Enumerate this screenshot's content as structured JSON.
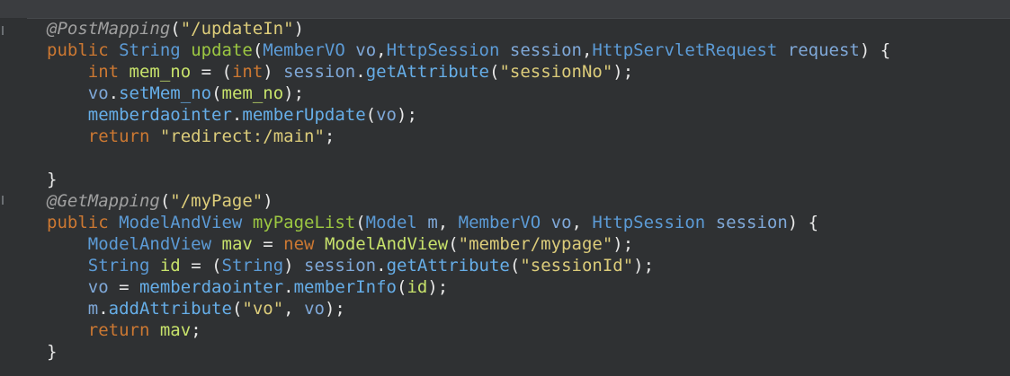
{
  "editor": {
    "lines": [
      [
        {
          "t": "@PostMapping",
          "c": "ann"
        },
        {
          "t": "(",
          "c": "punc"
        },
        {
          "t": "\"/updateIn\"",
          "c": "str"
        },
        {
          "t": ")",
          "c": "punc"
        }
      ],
      [
        {
          "t": "public",
          "c": "kw"
        },
        {
          "t": " ",
          "c": "punc"
        },
        {
          "t": "String",
          "c": "type"
        },
        {
          "t": " ",
          "c": "punc"
        },
        {
          "t": "update",
          "c": "fn"
        },
        {
          "t": "(",
          "c": "punc"
        },
        {
          "t": "MemberVO",
          "c": "type"
        },
        {
          "t": " ",
          "c": "punc"
        },
        {
          "t": "vo",
          "c": "param"
        },
        {
          "t": ",",
          "c": "punc"
        },
        {
          "t": "HttpSession",
          "c": "type"
        },
        {
          "t": " ",
          "c": "punc"
        },
        {
          "t": "session",
          "c": "param"
        },
        {
          "t": ",",
          "c": "punc"
        },
        {
          "t": "HttpServletRequest",
          "c": "type"
        },
        {
          "t": " ",
          "c": "punc"
        },
        {
          "t": "request",
          "c": "param"
        },
        {
          "t": ") {",
          "c": "punc"
        }
      ],
      [
        {
          "t": "    ",
          "c": "punc"
        },
        {
          "t": "int",
          "c": "kw"
        },
        {
          "t": " ",
          "c": "punc"
        },
        {
          "t": "mem_no",
          "c": "field"
        },
        {
          "t": " = (",
          "c": "op"
        },
        {
          "t": "int",
          "c": "kw"
        },
        {
          "t": ") ",
          "c": "punc"
        },
        {
          "t": "session",
          "c": "param"
        },
        {
          "t": ".",
          "c": "punc"
        },
        {
          "t": "getAttribute",
          "c": "call"
        },
        {
          "t": "(",
          "c": "punc"
        },
        {
          "t": "\"sessionNo\"",
          "c": "str"
        },
        {
          "t": ");",
          "c": "punc"
        }
      ],
      [
        {
          "t": "    ",
          "c": "punc"
        },
        {
          "t": "vo",
          "c": "param"
        },
        {
          "t": ".",
          "c": "punc"
        },
        {
          "t": "setMem_no",
          "c": "call"
        },
        {
          "t": "(",
          "c": "punc"
        },
        {
          "t": "mem_no",
          "c": "field"
        },
        {
          "t": ");",
          "c": "punc"
        }
      ],
      [
        {
          "t": "    ",
          "c": "punc"
        },
        {
          "t": "memberdaointer",
          "c": "call"
        },
        {
          "t": ".",
          "c": "punc"
        },
        {
          "t": "memberUpdate",
          "c": "call"
        },
        {
          "t": "(",
          "c": "punc"
        },
        {
          "t": "vo",
          "c": "param"
        },
        {
          "t": ");",
          "c": "punc"
        }
      ],
      [
        {
          "t": "    ",
          "c": "punc"
        },
        {
          "t": "return",
          "c": "kw"
        },
        {
          "t": " ",
          "c": "punc"
        },
        {
          "t": "\"redirect:/main\"",
          "c": "str"
        },
        {
          "t": ";",
          "c": "punc"
        }
      ],
      [
        {
          "t": "",
          "c": "punc"
        }
      ],
      [
        {
          "t": "}",
          "c": "punc"
        }
      ],
      [
        {
          "t": "@GetMapping",
          "c": "ann"
        },
        {
          "t": "(",
          "c": "punc"
        },
        {
          "t": "\"/myPage\"",
          "c": "str"
        },
        {
          "t": ")",
          "c": "punc"
        }
      ],
      [
        {
          "t": "public",
          "c": "kw"
        },
        {
          "t": " ",
          "c": "punc"
        },
        {
          "t": "ModelAndView",
          "c": "type"
        },
        {
          "t": " ",
          "c": "punc"
        },
        {
          "t": "myPageList",
          "c": "fn"
        },
        {
          "t": "(",
          "c": "punc"
        },
        {
          "t": "Model",
          "c": "type"
        },
        {
          "t": " ",
          "c": "punc"
        },
        {
          "t": "m",
          "c": "param"
        },
        {
          "t": ", ",
          "c": "punc"
        },
        {
          "t": "MemberVO",
          "c": "type"
        },
        {
          "t": " ",
          "c": "punc"
        },
        {
          "t": "vo",
          "c": "param"
        },
        {
          "t": ", ",
          "c": "punc"
        },
        {
          "t": "HttpSession",
          "c": "type"
        },
        {
          "t": " ",
          "c": "punc"
        },
        {
          "t": "session",
          "c": "param"
        },
        {
          "t": ") {",
          "c": "punc"
        }
      ],
      [
        {
          "t": "    ",
          "c": "punc"
        },
        {
          "t": "ModelAndView",
          "c": "type"
        },
        {
          "t": " ",
          "c": "punc"
        },
        {
          "t": "mav",
          "c": "field"
        },
        {
          "t": " = ",
          "c": "op"
        },
        {
          "t": "new",
          "c": "kw"
        },
        {
          "t": " ",
          "c": "punc"
        },
        {
          "t": "ModelAndView",
          "c": "field"
        },
        {
          "t": "(",
          "c": "punc"
        },
        {
          "t": "\"member/mypage\"",
          "c": "str"
        },
        {
          "t": ");",
          "c": "punc"
        }
      ],
      [
        {
          "t": "    ",
          "c": "punc"
        },
        {
          "t": "String",
          "c": "type"
        },
        {
          "t": " ",
          "c": "punc"
        },
        {
          "t": "id",
          "c": "field"
        },
        {
          "t": " = (",
          "c": "op"
        },
        {
          "t": "String",
          "c": "type"
        },
        {
          "t": ") ",
          "c": "punc"
        },
        {
          "t": "session",
          "c": "param"
        },
        {
          "t": ".",
          "c": "punc"
        },
        {
          "t": "getAttribute",
          "c": "call"
        },
        {
          "t": "(",
          "c": "punc"
        },
        {
          "t": "\"sessionId\"",
          "c": "str"
        },
        {
          "t": ");",
          "c": "punc"
        }
      ],
      [
        {
          "t": "    ",
          "c": "punc"
        },
        {
          "t": "vo",
          "c": "param"
        },
        {
          "t": " = ",
          "c": "op"
        },
        {
          "t": "memberdaointer",
          "c": "call"
        },
        {
          "t": ".",
          "c": "punc"
        },
        {
          "t": "memberInfo",
          "c": "call"
        },
        {
          "t": "(",
          "c": "punc"
        },
        {
          "t": "id",
          "c": "field"
        },
        {
          "t": ");",
          "c": "punc"
        }
      ],
      [
        {
          "t": "    ",
          "c": "punc"
        },
        {
          "t": "m",
          "c": "param"
        },
        {
          "t": ".",
          "c": "punc"
        },
        {
          "t": "addAttribute",
          "c": "call"
        },
        {
          "t": "(",
          "c": "punc"
        },
        {
          "t": "\"vo\"",
          "c": "str"
        },
        {
          "t": ", ",
          "c": "punc"
        },
        {
          "t": "vo",
          "c": "param"
        },
        {
          "t": ");",
          "c": "punc"
        }
      ],
      [
        {
          "t": "    ",
          "c": "punc"
        },
        {
          "t": "return",
          "c": "kw"
        },
        {
          "t": " ",
          "c": "punc"
        },
        {
          "t": "mav",
          "c": "field"
        },
        {
          "t": ";",
          "c": "punc"
        }
      ],
      [
        {
          "t": "}",
          "c": "punc"
        }
      ]
    ]
  },
  "theme": {
    "background": "#2f3133",
    "keyword": "#cc7832",
    "type": "#5c9bd6",
    "method": "#9cc742",
    "string": "#dccc7a",
    "annotation": "#a0a0a0"
  }
}
